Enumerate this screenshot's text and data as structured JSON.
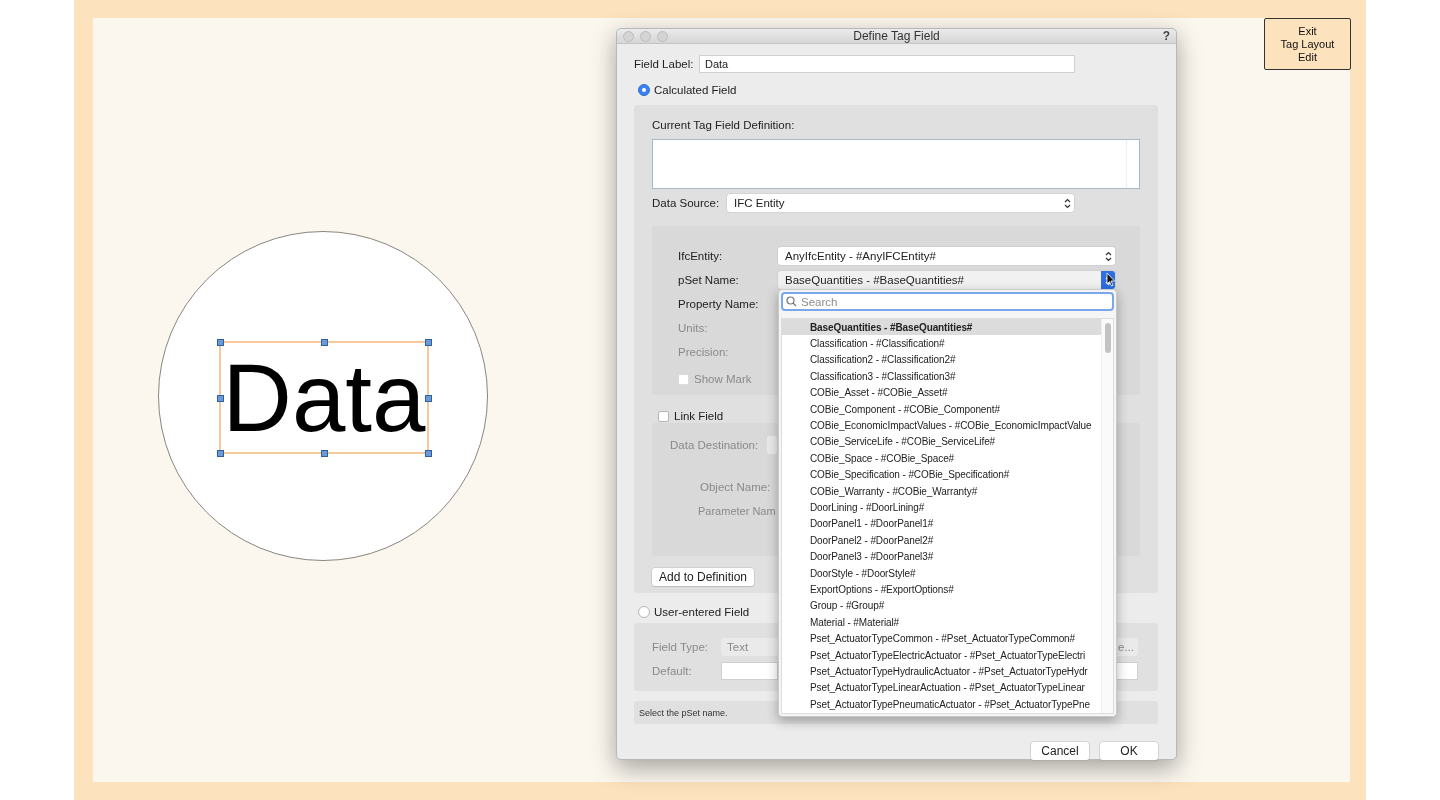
{
  "canvas": {
    "tag_text": "Data",
    "exit_button": "Exit\nTag Layout\nEdit"
  },
  "dialog": {
    "title": "Define Tag Field",
    "help_button": "?",
    "field_label": {
      "label": "Field Label:",
      "value": "Data"
    },
    "calculated": {
      "label": "Calculated Field",
      "selected": true,
      "definition_label": "Current Tag Field Definition:",
      "data_source": {
        "label": "Data Source:",
        "value": "IFC Entity"
      },
      "rows": [
        {
          "kind": "select",
          "label": "IfcEntity:",
          "value": "AnyIfcEntity - #AnyIFCEntity#",
          "disabled": false
        },
        {
          "kind": "select",
          "label": "pSet Name:",
          "value": "BaseQuantities - #BaseQuantities#",
          "disabled": false,
          "open": true
        },
        {
          "kind": "label",
          "label": "Property Name:",
          "disabled": false
        },
        {
          "kind": "label",
          "label": "Units:",
          "disabled": true
        },
        {
          "kind": "label",
          "label": "Precision:",
          "disabled": true
        }
      ],
      "show_mark": {
        "label": "Show Mark",
        "checked": false,
        "disabled": true
      }
    },
    "link": {
      "label": "Link Field",
      "checked": false,
      "data_destination": "Data Destination:",
      "object_name": "Object Name:",
      "parameter_name": "Parameter Nam"
    },
    "add_button": "Add to Definition",
    "user_entered": {
      "label": "User-entered Field",
      "selected": false,
      "field_type": {
        "label": "Field Type:",
        "value": "Text"
      },
      "side_button": "e...",
      "default": {
        "label": "Default:"
      }
    },
    "status": "Select the pSet name.",
    "buttons": [
      "Cancel",
      "OK"
    ]
  },
  "popup": {
    "search": {
      "placeholder": "Search"
    },
    "items": [
      {
        "label": "BaseQuantities - #BaseQuantities#",
        "selected": true
      },
      {
        "label": "Classification - #Classification#",
        "selected": false
      },
      {
        "label": "Classification2 - #Classification2#",
        "selected": false
      },
      {
        "label": "Classification3 - #Classification3#",
        "selected": false
      },
      {
        "label": "COBie_Asset - #COBie_Asset#",
        "selected": false
      },
      {
        "label": "COBie_Component - #COBie_Component#",
        "selected": false
      },
      {
        "label": "COBie_EconomicImpactValues - #COBie_EconomicImpactValue",
        "selected": false
      },
      {
        "label": "COBie_ServiceLife - #COBie_ServiceLife#",
        "selected": false
      },
      {
        "label": "COBie_Space - #COBie_Space#",
        "selected": false
      },
      {
        "label": "COBie_Specification - #COBie_Specification#",
        "selected": false
      },
      {
        "label": "COBie_Warranty - #COBie_Warranty#",
        "selected": false
      },
      {
        "label": "DoorLining - #DoorLining#",
        "selected": false
      },
      {
        "label": "DoorPanel1 - #DoorPanel1#",
        "selected": false
      },
      {
        "label": "DoorPanel2 - #DoorPanel2#",
        "selected": false
      },
      {
        "label": "DoorPanel3 - #DoorPanel3#",
        "selected": false
      },
      {
        "label": "DoorStyle - #DoorStyle#",
        "selected": false
      },
      {
        "label": "ExportOptions - #ExportOptions#",
        "selected": false
      },
      {
        "label": "Group - #Group#",
        "selected": false
      },
      {
        "label": "Material - #Material#",
        "selected": false
      },
      {
        "label": "Pset_ActuatorTypeCommon - #Pset_ActuatorTypeCommon#",
        "selected": false
      },
      {
        "label": "Pset_ActuatorTypeElectricActuator - #Pset_ActuatorTypeElectri",
        "selected": false
      },
      {
        "label": "Pset_ActuatorTypeHydraulicActuator - #Pset_ActuatorTypeHydr",
        "selected": false
      },
      {
        "label": "Pset_ActuatorTypeLinearActuation - #Pset_ActuatorTypeLinear",
        "selected": false
      },
      {
        "label": "Pset_ActuatorTypePneumaticActuator - #Pset_ActuatorTypePne",
        "selected": false
      }
    ]
  }
}
